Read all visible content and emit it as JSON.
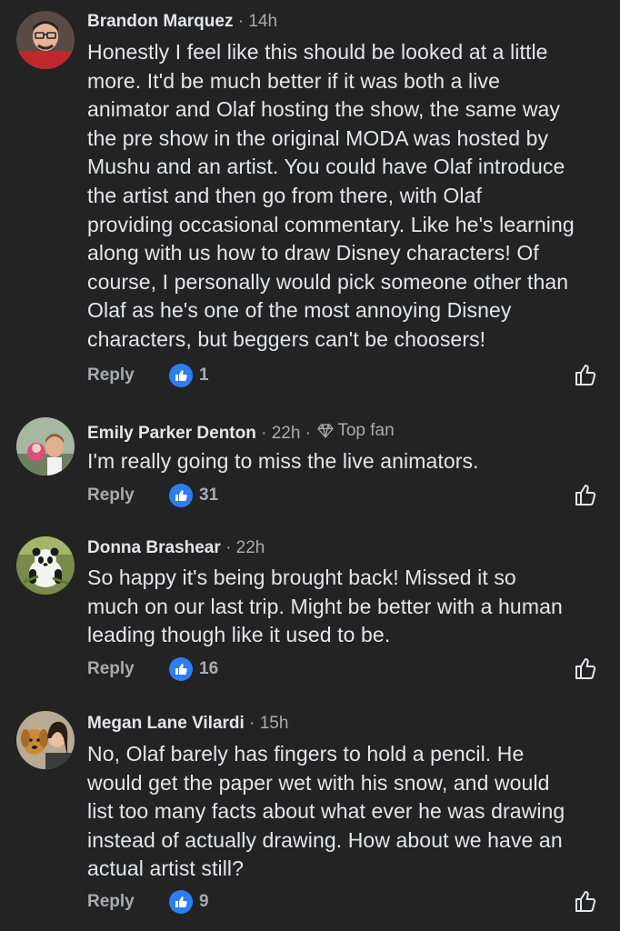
{
  "comments": [
    {
      "author": "Brandon Marquez",
      "time": "14h",
      "badge": "",
      "text": "Honestly I feel like this should be looked at a little\nmore. It'd be much better if it was both a live\nanimator and Olaf hosting the show, the same way\nthe pre show in the original MODA was hosted by\nMushu and an artist. You could have Olaf introduce\nthe artist and then go from there, with Olaf\nproviding occasional commentary. Like he's learning\nalong with us how to draw Disney characters! Of\ncourse, I personally would pick someone other than\nOlaf as he's one of the most annoying Disney\ncharacters, but beggers can't be choosers!",
      "reply_label": "Reply",
      "like_count": "1"
    },
    {
      "author": "Emily Parker Denton",
      "time": "22h",
      "badge": "Top fan",
      "text": "I'm really going to miss the live animators.",
      "reply_label": "Reply",
      "like_count": "31"
    },
    {
      "author": "Donna Brashear",
      "time": "22h",
      "badge": "",
      "text": "So happy it's being brought back!  Missed it so\nmuch on our last trip.  Might be better with a human\nleading though like it used to be.",
      "reply_label": "Reply",
      "like_count": "16"
    },
    {
      "author": "Megan Lane Vilardi",
      "time": "15h",
      "badge": "",
      "text": "No, Olaf barely has fingers to hold a pencil. He\nwould get the paper wet with his snow, and would\nlist too many facts about what ever he was drawing\ninstead of actually drawing. How about we have an\nactual artist still?",
      "reply_label": "Reply",
      "like_count": "9"
    }
  ],
  "separator": "·",
  "icons": {
    "like_reaction": "thumbs-up-icon",
    "like_button": "thumbs-up-outline-icon",
    "top_fan": "diamond-icon"
  },
  "colors": {
    "background": "#232324",
    "text": "#e4e6eb",
    "secondary": "#a8abaf",
    "accent": "#2d7ef0"
  }
}
